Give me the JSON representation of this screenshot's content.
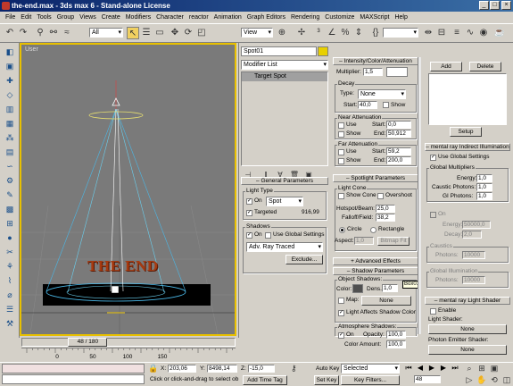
{
  "window": {
    "title": "the-end.max - 3ds max 6 - Stand-alone License",
    "min": "_",
    "max": "□",
    "close": "×"
  },
  "menu": [
    "File",
    "Edit",
    "Tools",
    "Group",
    "Views",
    "Create",
    "Modifiers",
    "Character",
    "reactor",
    "Animation",
    "Graph Editors",
    "Rendering",
    "Customize",
    "MAXScript",
    "Help"
  ],
  "toolbar": {
    "selection_filter": "All",
    "ref_coord": "View",
    "named_sel": ""
  },
  "viewport": {
    "label": "User",
    "text3d": "THE END"
  },
  "timeslider": {
    "label": "48 / 180",
    "ticks": [
      "0",
      "50",
      "100",
      "150"
    ],
    "position": 0.267
  },
  "modify": {
    "object_name": "Spot01",
    "modifier_list": "Modifier List",
    "stack_item": "Target Spot"
  },
  "general": {
    "header": "General Parameters",
    "light_type": "Light Type",
    "on_label": "On",
    "type_value": "Spot",
    "targeted_label": "Targeted",
    "targeted_distance": "916,99",
    "shadows": "Shadows",
    "shadows_on": "On",
    "use_global": "Use Global Settings",
    "shadow_type": "Adv. Ray Traced",
    "exclude": "Exclude..."
  },
  "intensity": {
    "header": "Intensity/Color/Attenuation",
    "multiplier_label": "Multiplier:",
    "multiplier": "1,5",
    "decay": "Decay",
    "type_label": "Type:",
    "type_value": "None",
    "start_label": "Start:",
    "start": "40,0",
    "show": "Show",
    "near_atten": "Near Attenuation",
    "use": "Use",
    "near_start": "0,0",
    "end_label": "End:",
    "near_end": "50,912",
    "far_atten": "Far Attenuation",
    "far_start": "59,2",
    "far_end": "200,0"
  },
  "spotlight": {
    "header": "Spotlight Parameters",
    "light_cone": "Light Cone",
    "show_cone": "Show Cone",
    "overshoot": "Overshoot",
    "hotspot_label": "Hotspot/Beam:",
    "hotspot": "25,0",
    "falloff_label": "Falloff/Field:",
    "falloff": "38,2",
    "circle": "Circle",
    "rectangle": "Rectangle",
    "aspect_label": "Aspect:",
    "aspect": "1,0",
    "bitmap_fit": "Bitmap Fit"
  },
  "advanced": {
    "header": "Advanced Effects"
  },
  "shadowparams": {
    "header": "Shadow Parameters",
    "object_shadows": "Object Shadows:",
    "color_label": "Color:",
    "dens_label": "Dens.",
    "dens": "1,0",
    "map_label": "Map:",
    "map_value": "None",
    "light_affects": "Light Affects Shadow Color",
    "tooltip": "Box01",
    "atmos": "Atmosphere Shadows:",
    "atmos_on": "On",
    "opacity_label": "Opacity:",
    "opacity": "100,0",
    "color_amount_label": "Color Amount:",
    "color_amount": "100,0"
  },
  "mrpanel": {
    "add": "Add",
    "delete": "Delete",
    "setup": "Setup",
    "indirect_header": "mental ray Indirect Illumination",
    "use_global": "Use Global Settings",
    "global_mult": "Global Multipliers",
    "energy_label": "Energy:",
    "energy": "1,0",
    "caustic_label": "Caustic Photons:",
    "caustic": "1,0",
    "gi_label": "GI Photons:",
    "gi": "1,0",
    "on": "On",
    "energy2_label": "Energy:",
    "energy2": "50000,0",
    "decay_label": "Decay:",
    "decay": "2,0",
    "caustics": "Caustics",
    "photons_label": "Photons:",
    "photons1": "10000",
    "global_illum": "Global Illumination",
    "photons2": "10000",
    "shader_header": "mental ray Light Shader",
    "enable": "Enable",
    "light_shader": "Light Shader:",
    "light_shader_value": "None",
    "photon_emitter": "Photon Emitter Shader:",
    "photon_emitter_value": "None"
  },
  "statusbar": {
    "x_label": "X:",
    "x": "203,06",
    "y_label": "Y:",
    "y": "8498,14",
    "z_label": "Z:",
    "z": "-15,0",
    "prompt": "Click or click-and-drag to select ob",
    "add_time_tag": "Add Time Tag",
    "auto_key": "Auto Key",
    "selected": "Selected",
    "set_key": "Set Key",
    "key_filters": "Key Filters...",
    "frame": "48"
  },
  "colors": {
    "accent": "#e8c000",
    "title_bg": "#0a246a",
    "lightcolor": "#ffffff"
  }
}
